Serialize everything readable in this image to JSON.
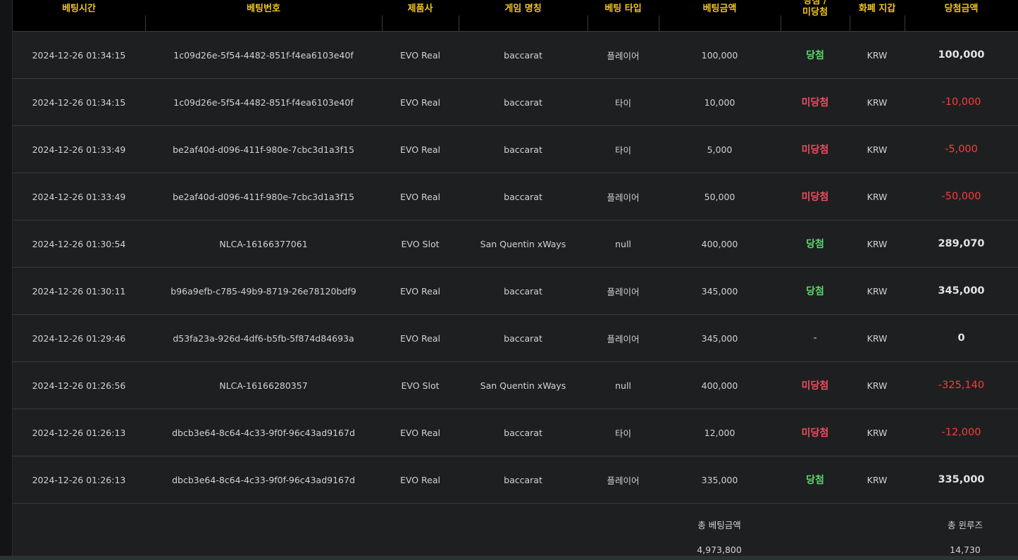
{
  "columns": [
    {
      "key": "time",
      "label": "베팅시간"
    },
    {
      "key": "bet_id",
      "label": "베팅번호"
    },
    {
      "key": "provider",
      "label": "제품사"
    },
    {
      "key": "game",
      "label": "게임 명칭"
    },
    {
      "key": "bet_type",
      "label": "베팅 타입"
    },
    {
      "key": "bet_amount",
      "label": "베팅금액"
    },
    {
      "key": "result",
      "label": "당첨 /\n미당첨"
    },
    {
      "key": "currency",
      "label": "화폐 지갑"
    },
    {
      "key": "win_amount",
      "label": "당첨금액"
    }
  ],
  "rows": [
    {
      "time": "2024-12-26 01:34:15",
      "bet_id": "1c09d26e-5f54-4482-851f-f4ea6103e40f",
      "provider": "EVO Real",
      "game": "baccarat",
      "bet_type": "플레이어",
      "bet_amount": "100,000",
      "result": "당첨",
      "result_kind": "win",
      "currency": "KRW",
      "win_amount": "100,000"
    },
    {
      "time": "2024-12-26 01:34:15",
      "bet_id": "1c09d26e-5f54-4482-851f-f4ea6103e40f",
      "provider": "EVO Real",
      "game": "baccarat",
      "bet_type": "타이",
      "bet_amount": "10,000",
      "result": "미당첨",
      "result_kind": "lose",
      "currency": "KRW",
      "win_amount": "-10,000"
    },
    {
      "time": "2024-12-26 01:33:49",
      "bet_id": "be2af40d-d096-411f-980e-7cbc3d1a3f15",
      "provider": "EVO Real",
      "game": "baccarat",
      "bet_type": "타이",
      "bet_amount": "5,000",
      "result": "미당첨",
      "result_kind": "lose",
      "currency": "KRW",
      "win_amount": "-5,000"
    },
    {
      "time": "2024-12-26 01:33:49",
      "bet_id": "be2af40d-d096-411f-980e-7cbc3d1a3f15",
      "provider": "EVO Real",
      "game": "baccarat",
      "bet_type": "플레이어",
      "bet_amount": "50,000",
      "result": "미당첨",
      "result_kind": "lose",
      "currency": "KRW",
      "win_amount": "-50,000"
    },
    {
      "time": "2024-12-26 01:30:54",
      "bet_id": "NLCA-16166377061",
      "provider": "EVO Slot",
      "game": "San Quentin xWays",
      "bet_type": "null",
      "bet_amount": "400,000",
      "result": "당첨",
      "result_kind": "win",
      "currency": "KRW",
      "win_amount": "289,070"
    },
    {
      "time": "2024-12-26 01:30:11",
      "bet_id": "b96a9efb-c785-49b9-8719-26e78120bdf9",
      "provider": "EVO Real",
      "game": "baccarat",
      "bet_type": "플레이어",
      "bet_amount": "345,000",
      "result": "당첨",
      "result_kind": "win",
      "currency": "KRW",
      "win_amount": "345,000"
    },
    {
      "time": "2024-12-26 01:29:46",
      "bet_id": "d53fa23a-926d-4df6-b5fb-5f874d84693a",
      "provider": "EVO Real",
      "game": "baccarat",
      "bet_type": "플레이어",
      "bet_amount": "345,000",
      "result": "-",
      "result_kind": "neutral",
      "currency": "KRW",
      "win_amount": "0"
    },
    {
      "time": "2024-12-26 01:26:56",
      "bet_id": "NLCA-16166280357",
      "provider": "EVO Slot",
      "game": "San Quentin xWays",
      "bet_type": "null",
      "bet_amount": "400,000",
      "result": "미당첨",
      "result_kind": "lose",
      "currency": "KRW",
      "win_amount": "-325,140"
    },
    {
      "time": "2024-12-26 01:26:13",
      "bet_id": "dbcb3e64-8c64-4c33-9f0f-96c43ad9167d",
      "provider": "EVO Real",
      "game": "baccarat",
      "bet_type": "타이",
      "bet_amount": "12,000",
      "result": "미당첨",
      "result_kind": "lose",
      "currency": "KRW",
      "win_amount": "-12,000"
    },
    {
      "time": "2024-12-26 01:26:13",
      "bet_id": "dbcb3e64-8c64-4c33-9f0f-96c43ad9167d",
      "provider": "EVO Real",
      "game": "baccarat",
      "bet_type": "플레이어",
      "bet_amount": "335,000",
      "result": "당첨",
      "result_kind": "win",
      "currency": "KRW",
      "win_amount": "335,000"
    }
  ],
  "summary": {
    "total_bet_label": "총 베팅금액",
    "total_bet_value": "4,973,800",
    "total_winloss_label": "총 윈루즈",
    "total_winloss_value": "14,730"
  },
  "colors": {
    "header_text": "#f2c718",
    "win": "#5bd86a",
    "lose": "#ef4d5f",
    "negative_amount": "#ff3b3b"
  }
}
